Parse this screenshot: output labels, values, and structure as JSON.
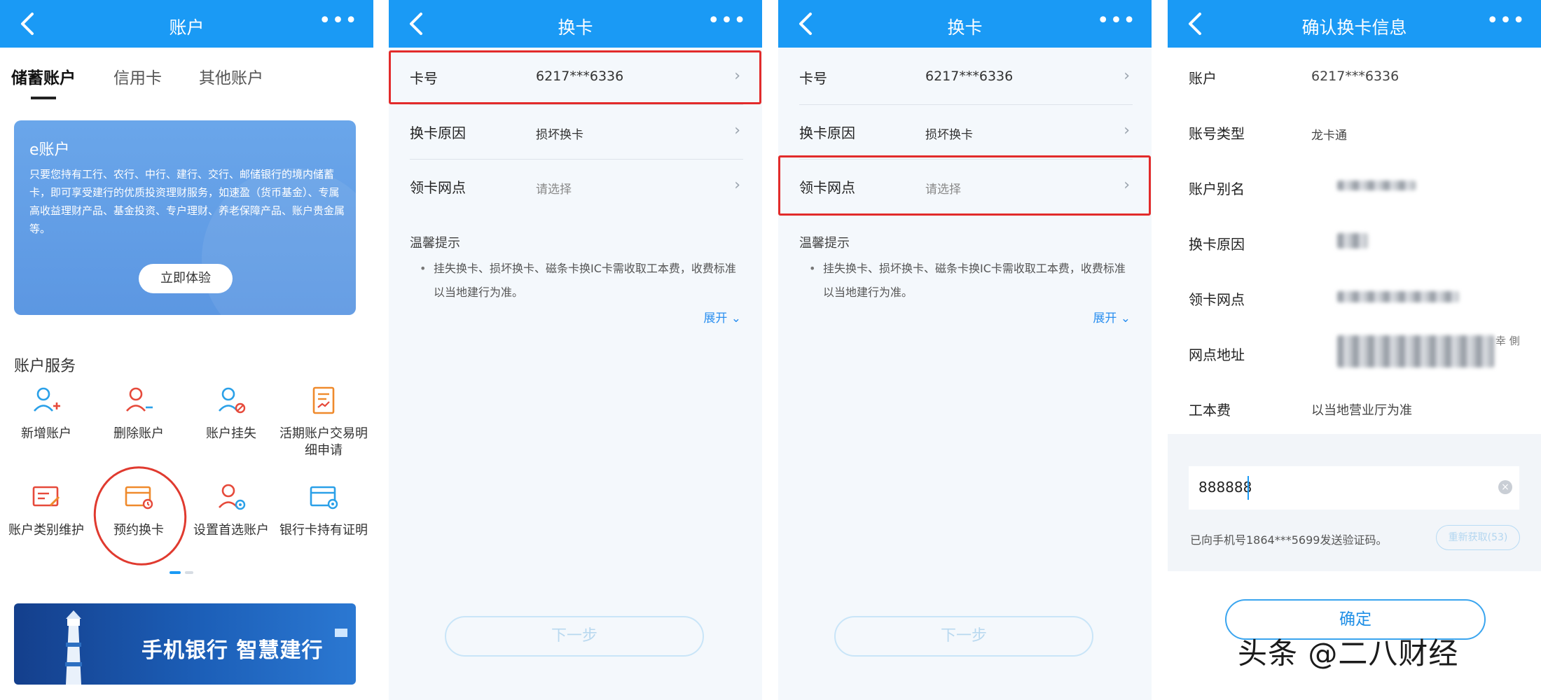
{
  "screen1": {
    "header": {
      "title": "账户",
      "more": "•••"
    },
    "tabs": [
      "储蓄账户",
      "信用卡",
      "其他账户"
    ],
    "ecard": {
      "title": "e账户",
      "description": "只要您持有工行、农行、中行、建行、交行、邮储银行的境内储蓄卡，即可享受建行的优质投资理财服务，如速盈（货币基金）、专属高收益理财产品、基金投资、专户理财、养老保障产品、账户贵金属等。",
      "button": "立即体验"
    },
    "services_title": "账户服务",
    "services": [
      {
        "label": "新增账户",
        "icon": "add-account-icon"
      },
      {
        "label": "删除账户",
        "icon": "remove-account-icon"
      },
      {
        "label": "账户挂失",
        "icon": "report-loss-icon"
      },
      {
        "label": "活期账户交易明细申请",
        "icon": "statement-request-icon"
      },
      {
        "label": "账户类别维护",
        "icon": "account-type-edit-icon"
      },
      {
        "label": "预约换卡",
        "icon": "card-replace-icon"
      },
      {
        "label": "设置首选账户",
        "icon": "preferred-account-icon"
      },
      {
        "label": "银行卡持有证明",
        "icon": "card-certificate-icon"
      }
    ],
    "banner_text": "手机银行  智慧建行"
  },
  "screen2": {
    "header": {
      "title": "换卡",
      "more": "•••"
    },
    "rows": [
      {
        "label": "卡号",
        "value": "6217***6336"
      },
      {
        "label": "换卡原因",
        "value": "损坏换卡"
      },
      {
        "label": "领卡网点",
        "value": "请选择"
      }
    ],
    "tips_title": "温馨提示",
    "tips_body": "挂失换卡、损坏换卡、磁条卡换IC卡需收取工本费，收费标准以当地建行为准。",
    "expand": "展开",
    "next": "下一步"
  },
  "screen3": {
    "header": {
      "title": "换卡",
      "more": "•••"
    },
    "rows": [
      {
        "label": "卡号",
        "value": "6217***6336"
      },
      {
        "label": "换卡原因",
        "value": "损坏换卡"
      },
      {
        "label": "领卡网点",
        "value": "请选择"
      }
    ],
    "tips_title": "温馨提示",
    "tips_body": "挂失换卡、损坏换卡、磁条卡换IC卡需收取工本费，收费标准以当地建行为准。",
    "expand": "展开",
    "next": "下一步"
  },
  "screen4": {
    "header": {
      "title": "确认换卡信息",
      "more": "•••"
    },
    "rows": [
      {
        "label": "账户",
        "value": "6217***6336"
      },
      {
        "label": "账号类型",
        "value": "龙卡通"
      },
      {
        "label": "账户别名",
        "value": ""
      },
      {
        "label": "换卡原因",
        "value": ""
      },
      {
        "label": "领卡网点",
        "value": ""
      },
      {
        "label": "网点地址",
        "value": "",
        "side_text": "幸 側"
      },
      {
        "label": "工本费",
        "value": "以当地营业厅为准"
      }
    ],
    "code_value": "888888",
    "sms_notice": "已向手机号1864***5699发送验证码。",
    "resend": "重新获取(53)",
    "confirm": "确定"
  },
  "watermark": "头条 @二八财经",
  "colors": {
    "header_blue": "#1a9af5",
    "highlight_red": "#e22b2b",
    "link_blue": "#2a8ff0"
  }
}
